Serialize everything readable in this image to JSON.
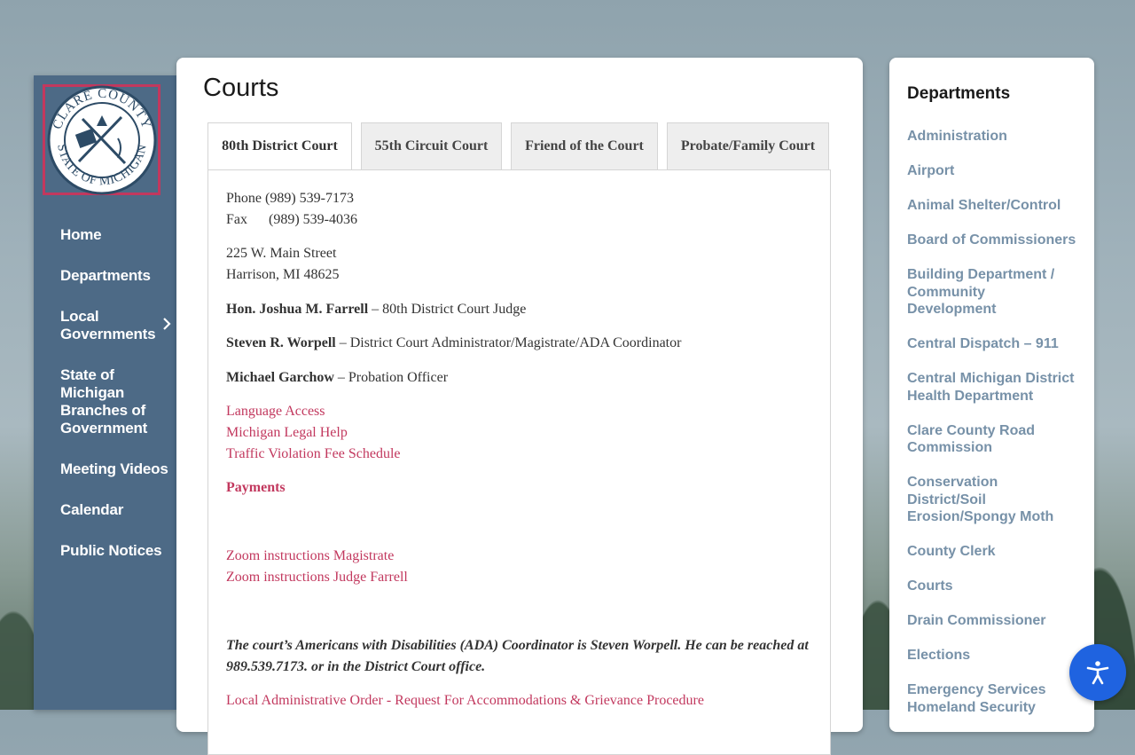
{
  "logo": {
    "alt": "Clare County State of Michigan seal",
    "ring_text_top": "CLARE COUNTY",
    "ring_text_bottom": "STATE OF MICHIGAN"
  },
  "nav": {
    "items": [
      {
        "label": "Home"
      },
      {
        "label": "Departments"
      },
      {
        "label": "Local Governments",
        "has_submenu": true
      },
      {
        "label": "State of Michigan Branches of Government"
      },
      {
        "label": "Meeting Videos"
      },
      {
        "label": "Calendar"
      },
      {
        "label": "Public Notices"
      }
    ]
  },
  "main": {
    "title": "Courts",
    "tabs": [
      {
        "label": "80th District Court",
        "active": true
      },
      {
        "label": "55th Circuit Court"
      },
      {
        "label": "Friend of the Court"
      },
      {
        "label": "Probate/Family Court"
      }
    ],
    "panel": {
      "phone_label": "Phone",
      "phone": "(989) 539-7173",
      "fax_label": "Fax",
      "fax": "(989) 539-4036",
      "address_line1": "225 W. Main Street",
      "address_line2": "Harrison, MI 48625",
      "judge_name": "Hon. Joshua M. Farrell",
      "judge_role": "– 80th District Court Judge",
      "admin_name": "Steven R. Worpell",
      "admin_role": "– District Court Administrator/Magistrate/ADA Coordinator",
      "probation_name": "Michael Garchow",
      "probation_role": "– Probation Officer",
      "links": [
        "Language Access",
        "Michigan Legal Help",
        "Traffic Violation Fee Schedule"
      ],
      "payments": "Payments",
      "zoom_links": [
        "Zoom instructions Magistrate",
        "Zoom instructions Judge Farrell"
      ],
      "ada_note": "The court’s Americans with Disabilities (ADA) Coordinator is Steven Worpell. He can be reached at 989.539.7173. or in the District Court office.",
      "order_link": "Local Administrative Order - Request For Accommodations & Grievance Procedure"
    }
  },
  "departments": {
    "title": "Departments",
    "items": [
      "Administration",
      "Airport",
      "Animal Shelter/Control",
      "Board of Commissioners",
      "Building Department / Community Development",
      "Central Dispatch – 911",
      "Central Michigan District Health Department",
      "Clare County Road Commission",
      "Conservation District/Soil Erosion/Spongy Moth",
      "County Clerk",
      "Courts",
      "Drain Commissioner",
      "Elections",
      "Emergency Services Homeland Security"
    ]
  },
  "accessibility": {
    "icon": "accessibility-icon"
  },
  "colors": {
    "nav_bg": "#4d6a86",
    "link": "#c2385e",
    "dept_link": "#7791a8",
    "a11y": "#1f63e0"
  }
}
